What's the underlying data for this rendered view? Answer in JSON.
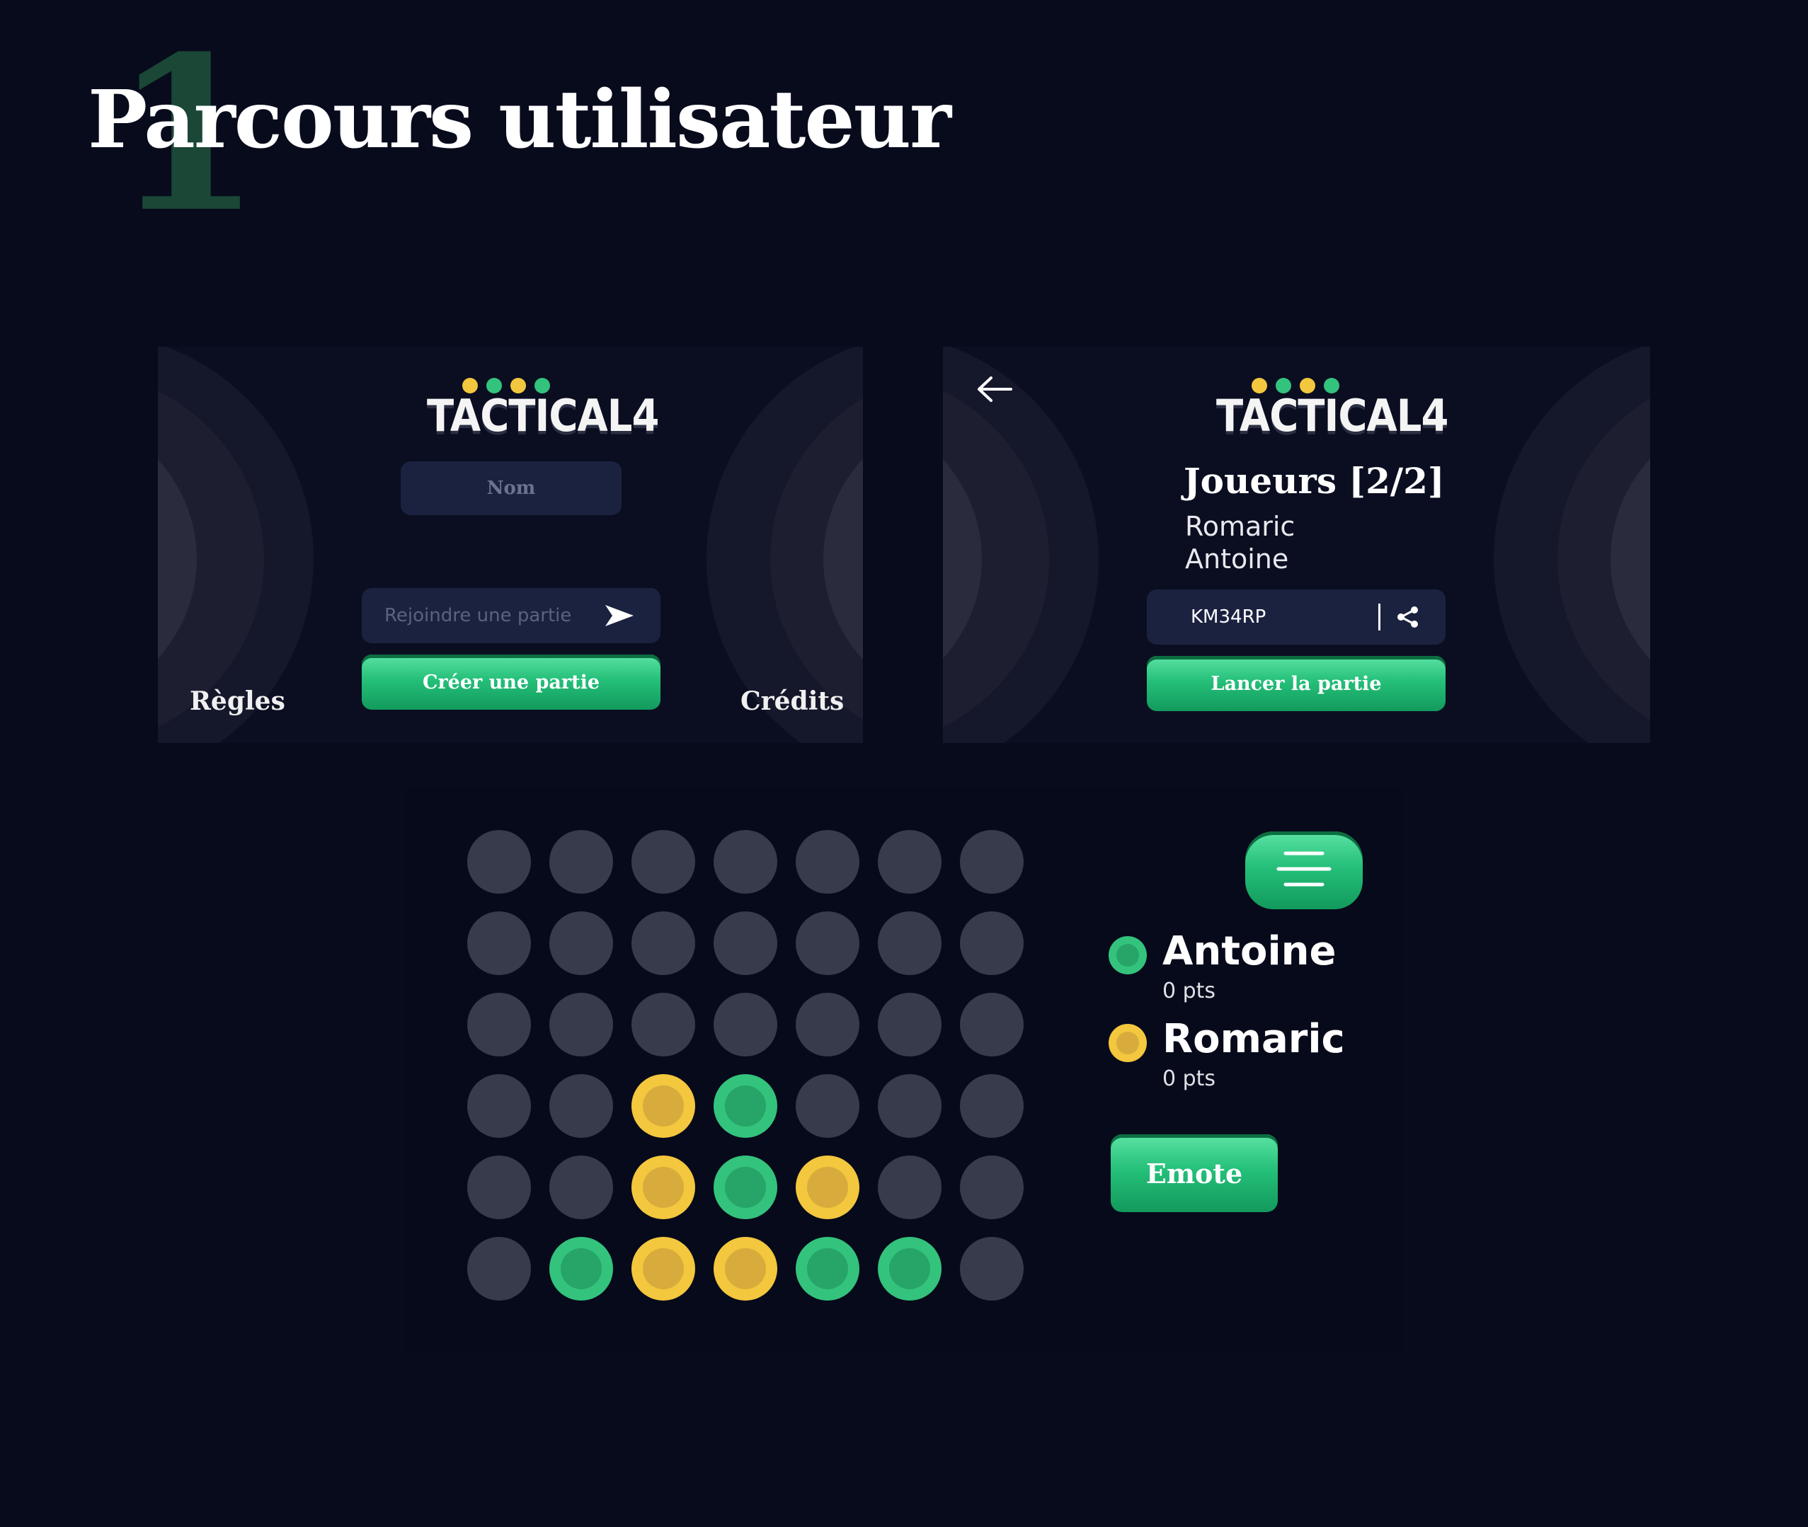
{
  "page": {
    "step_number": "1",
    "title": "Parcours utilisateur"
  },
  "colors": {
    "background": "#080b1c",
    "accent_green": "#33c37d",
    "accent_yellow": "#f3c73e",
    "empty_cell": "#383b4c",
    "field_bg": "#1b2240"
  },
  "logo": {
    "text": "TACTICAL4",
    "dot_colors": [
      "#f3c73e",
      "#33c37d",
      "#f3c73e",
      "#33c37d"
    ]
  },
  "home_screen": {
    "name_placeholder": "Nom",
    "join_placeholder": "Rejoindre une partie",
    "join_icon": "send-arrow-icon",
    "create_button": "Créer une partie",
    "rules_link": "Règles",
    "credits_link": "Crédits"
  },
  "lobby_screen": {
    "back_icon": "arrow-left-icon",
    "players_heading": "Joueurs [2/2]",
    "players": [
      "Romaric",
      "Antoine"
    ],
    "room_code": "KM34RP",
    "share_icon": "share-icon",
    "launch_button": "Lancer la partie"
  },
  "game_screen": {
    "menu_icon": "menu-lines-icon",
    "board": {
      "columns": 7,
      "rows": 6,
      "cells": [
        [
          "empty",
          "empty",
          "empty",
          "empty",
          "empty",
          "empty",
          "empty"
        ],
        [
          "empty",
          "empty",
          "empty",
          "empty",
          "empty",
          "empty",
          "empty"
        ],
        [
          "empty",
          "empty",
          "empty",
          "empty",
          "empty",
          "empty",
          "empty"
        ],
        [
          "empty",
          "empty",
          "yellow",
          "green",
          "empty",
          "empty",
          "empty"
        ],
        [
          "empty",
          "empty",
          "yellow",
          "green",
          "yellow",
          "empty",
          "empty"
        ],
        [
          "empty",
          "green",
          "yellow",
          "yellow",
          "green",
          "green",
          "empty"
        ]
      ]
    },
    "players": [
      {
        "name": "Antoine",
        "score": "0 pts",
        "color": "green"
      },
      {
        "name": "Romaric",
        "score": "0 pts",
        "color": "yellow"
      }
    ],
    "emote_button": "Emote"
  }
}
